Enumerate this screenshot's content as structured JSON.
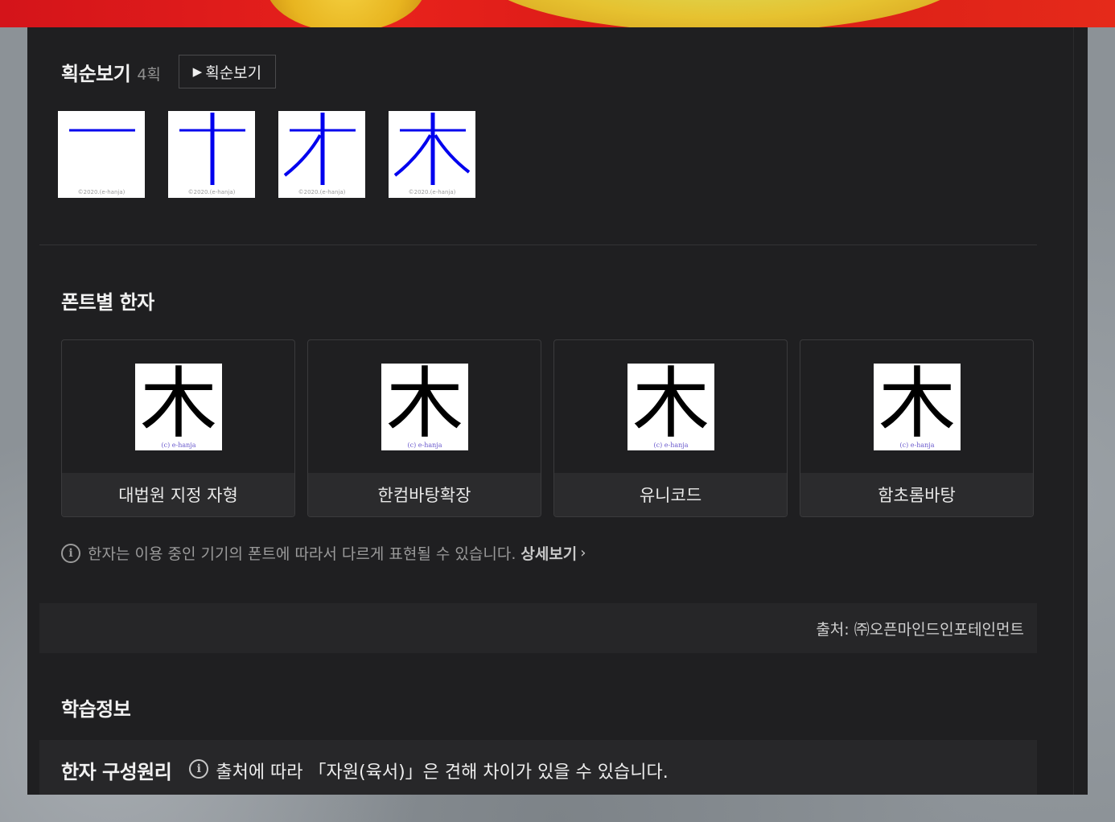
{
  "stroke_order": {
    "title": "획순보기",
    "count": "4획",
    "button_label": "획순보기",
    "images": [
      {
        "copyright": "©2020.(e-hanja)",
        "strokes": 1
      },
      {
        "copyright": "©2020.(e-hanja)",
        "strokes": 2
      },
      {
        "copyright": "©2020.(e-hanja)",
        "strokes": 3
      },
      {
        "copyright": "©2020.(e-hanja)",
        "strokes": 4
      }
    ]
  },
  "fonts": {
    "title": "폰트별 한자",
    "character": "木",
    "watermark": "(c) e-hanja",
    "cards": [
      {
        "label": "대법원 지정 자형"
      },
      {
        "label": "한컴바탕확장"
      },
      {
        "label": "유니코드"
      },
      {
        "label": "함초롬바탕"
      }
    ],
    "notice": "한자는 이용 중인 기기의 폰트에 따라서 다르게 표현될 수 있습니다.",
    "more_link": "상세보기"
  },
  "source": "출처: ㈜오픈마인드인포테인먼트",
  "study": {
    "title": "학습정보",
    "principle_title": "한자 구성원리",
    "principle_note": "출처에 따라 「자원(육서)」은 견해 차이가 있을 수 있습니다."
  },
  "colors": {
    "stroke_blue": "#0000ee",
    "panel_bg": "#1f1f21",
    "banner_red": "#d4141a"
  }
}
